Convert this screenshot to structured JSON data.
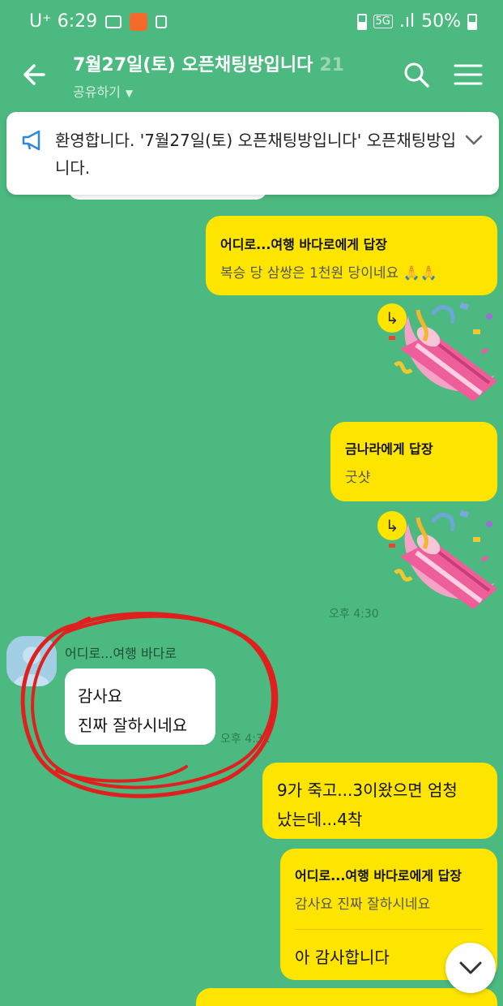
{
  "status_bar": {
    "carrier": "U⁺ 6:29",
    "temu_icon": "temu-app-icon",
    "network": "5G",
    "battery": "50%"
  },
  "header": {
    "title": "7월27일(토) 오픈채팅방입니다",
    "member_count": "21",
    "share_label": "공유하기"
  },
  "notice": {
    "text": "환영합니다. '7월27일(토) 오픈채팅방입니다' 오픈채팅방입니다."
  },
  "messages": {
    "m1": {
      "reply_to": "어디로...여행 바다로에게 답장",
      "quote": "복승 당 삼쌍은 1천원 당이네요 🙏🙏"
    },
    "m2": {
      "reply_to": "금나라에게 답장",
      "quote": "굿샷"
    },
    "time1": "오후 4:30",
    "incoming": {
      "sender": "어디로...여행 바다로",
      "line1": "감사요",
      "line2": "진짜 잘하시네요",
      "time": "오후 4:31"
    },
    "m3": {
      "line1": "9가 죽고...3이왔으면 엄청",
      "line2": "났는데...4착"
    },
    "m4": {
      "reply_to": "어디로...여행 바다로에게 답장",
      "quote": "감사요 진짜 잘하시네요",
      "text": "아 감사합니다"
    }
  },
  "colors": {
    "background": "#4cb980",
    "my_bubble": "#fee500",
    "their_bubble": "#ffffff",
    "annotation": "#e0201e"
  }
}
